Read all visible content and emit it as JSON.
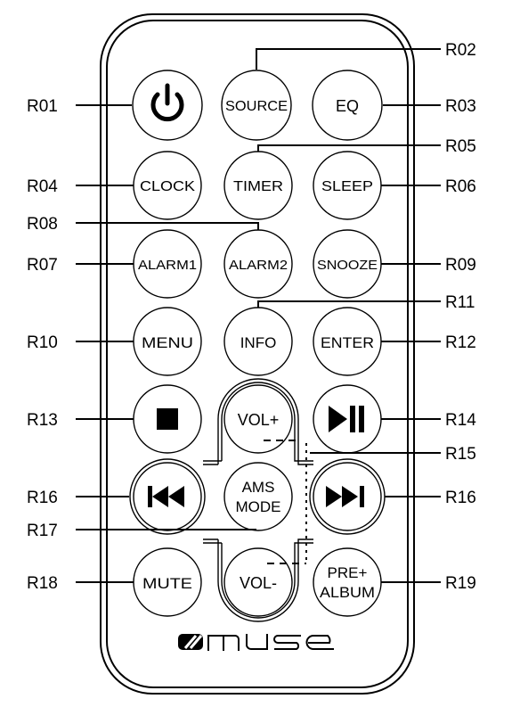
{
  "brand": {
    "logo_text": "muse"
  },
  "buttons": {
    "power": {
      "icon": "power-icon"
    },
    "source": "SOURCE",
    "eq": "EQ",
    "clock": "CLOCK",
    "timer": "TIMER",
    "sleep": "SLEEP",
    "alarm1": "ALARM1",
    "alarm2": "ALARM2",
    "snooze": "SNOOZE",
    "menu": "MENU",
    "info": "INFO",
    "enter": "ENTER",
    "stop": {
      "icon": "stop-icon"
    },
    "vol_up": "VOL+",
    "play_pause": {
      "icon": "play-pause-icon"
    },
    "prev": {
      "icon": "skip-previous-icon"
    },
    "ams_mode": [
      "AMS",
      "MODE"
    ],
    "next": {
      "icon": "skip-next-icon"
    },
    "mute": "MUTE",
    "vol_down": "VOL-",
    "pre_album": [
      "PRE+",
      "ALBUM"
    ]
  },
  "callouts": {
    "r01": "R01",
    "r02": "R02",
    "r03": "R03",
    "r04": "R04",
    "r05": "R05",
    "r06": "R06",
    "r07": "R07",
    "r08": "R08",
    "r09": "R09",
    "r10": "R10",
    "r11": "R11",
    "r12": "R12",
    "r13": "R13",
    "r14": "R14",
    "r15": "R15",
    "r16_left": "R16",
    "r16_right": "R16",
    "r17": "R17",
    "r18": "R18",
    "r19": "R19"
  }
}
